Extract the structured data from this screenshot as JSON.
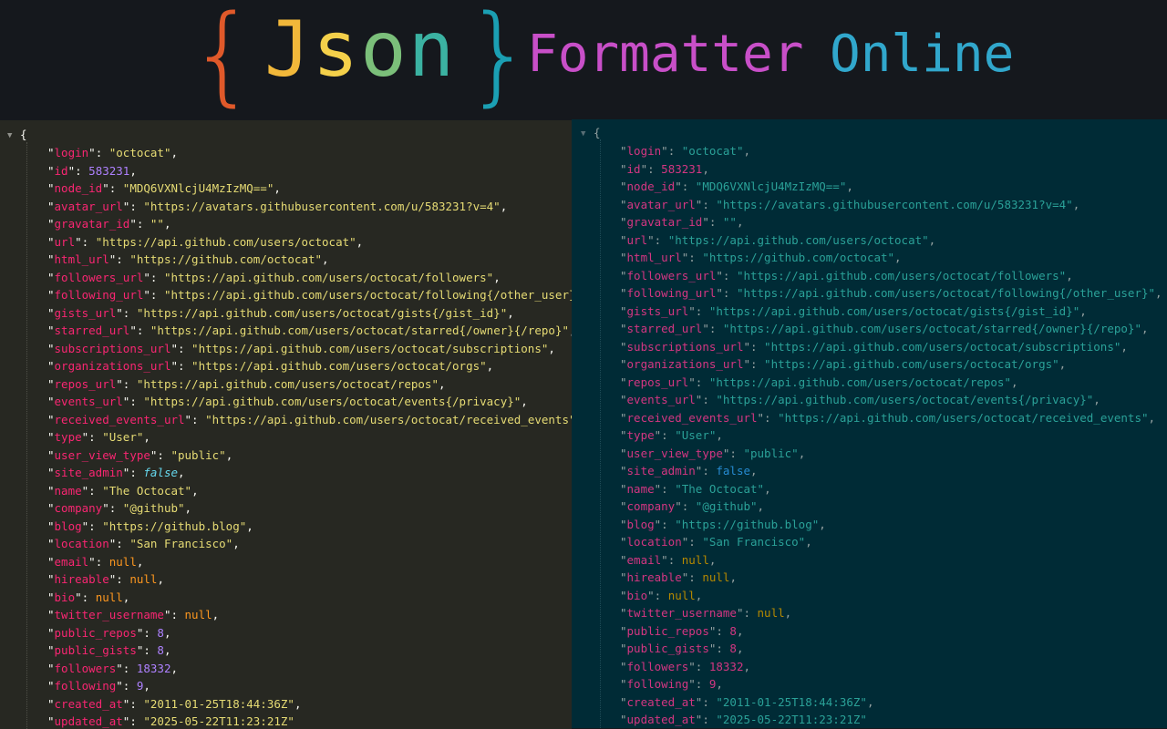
{
  "banner": {
    "brace_open": "{",
    "word_json": [
      "J",
      "s",
      "o",
      "n"
    ],
    "brace_close": "}",
    "word_formatter": "Formatter",
    "word_online": "Online"
  },
  "editor": {
    "root_open": "{",
    "fold_icon": "triangle-down",
    "colors": {
      "left_background": "#272822",
      "right_background": "#002b36",
      "banner_background": "#15181d"
    },
    "entries": [
      {
        "key": "login",
        "value": "\"octocat\"",
        "type": "string",
        "comma": ","
      },
      {
        "key": "id",
        "value": "583231",
        "type": "number",
        "comma": ","
      },
      {
        "key": "node_id",
        "value": "\"MDQ6VXNlcjU4MzIzMQ==\"",
        "type": "string",
        "comma": ","
      },
      {
        "key": "avatar_url",
        "value": "\"https://avatars.githubusercontent.com/u/583231?v=4\"",
        "type": "string",
        "comma": ","
      },
      {
        "key": "gravatar_id",
        "value": "\"\"",
        "type": "string",
        "comma": ","
      },
      {
        "key": "url",
        "value": "\"https://api.github.com/users/octocat\"",
        "type": "string",
        "comma": ","
      },
      {
        "key": "html_url",
        "value": "\"https://github.com/octocat\"",
        "type": "string",
        "comma": ","
      },
      {
        "key": "followers_url",
        "value": "\"https://api.github.com/users/octocat/followers\"",
        "type": "string",
        "comma": ","
      },
      {
        "key": "following_url",
        "value": "\"https://api.github.com/users/octocat/following{/other_user}\"",
        "type": "string",
        "comma": ","
      },
      {
        "key": "gists_url",
        "value": "\"https://api.github.com/users/octocat/gists{/gist_id}\"",
        "type": "string",
        "comma": ","
      },
      {
        "key": "starred_url",
        "value": "\"https://api.github.com/users/octocat/starred{/owner}{/repo}\"",
        "type": "string",
        "comma": ","
      },
      {
        "key": "subscriptions_url",
        "value": "\"https://api.github.com/users/octocat/subscriptions\"",
        "type": "string",
        "comma": ","
      },
      {
        "key": "organizations_url",
        "value": "\"https://api.github.com/users/octocat/orgs\"",
        "type": "string",
        "comma": ","
      },
      {
        "key": "repos_url",
        "value": "\"https://api.github.com/users/octocat/repos\"",
        "type": "string",
        "comma": ","
      },
      {
        "key": "events_url",
        "value": "\"https://api.github.com/users/octocat/events{/privacy}\"",
        "type": "string",
        "comma": ","
      },
      {
        "key": "received_events_url",
        "value": "\"https://api.github.com/users/octocat/received_events\"",
        "type": "string",
        "comma": ","
      },
      {
        "key": "type",
        "value": "\"User\"",
        "type": "string",
        "comma": ","
      },
      {
        "key": "user_view_type",
        "value": "\"public\"",
        "type": "string",
        "comma": ","
      },
      {
        "key": "site_admin",
        "value": "false",
        "type": "boolean",
        "comma": ","
      },
      {
        "key": "name",
        "value": "\"The Octocat\"",
        "type": "string",
        "comma": ","
      },
      {
        "key": "company",
        "value": "\"@github\"",
        "type": "string",
        "comma": ","
      },
      {
        "key": "blog",
        "value": "\"https://github.blog\"",
        "type": "string",
        "comma": ","
      },
      {
        "key": "location",
        "value": "\"San Francisco\"",
        "type": "string",
        "comma": ","
      },
      {
        "key": "email",
        "value": "null",
        "type": "null",
        "comma": ","
      },
      {
        "key": "hireable",
        "value": "null",
        "type": "null",
        "comma": ","
      },
      {
        "key": "bio",
        "value": "null",
        "type": "null",
        "comma": ","
      },
      {
        "key": "twitter_username",
        "value": "null",
        "type": "null",
        "comma": ","
      },
      {
        "key": "public_repos",
        "value": "8",
        "type": "number",
        "comma": ","
      },
      {
        "key": "public_gists",
        "value": "8",
        "type": "number",
        "comma": ","
      },
      {
        "key": "followers",
        "value": "18332",
        "type": "number",
        "comma": ","
      },
      {
        "key": "following",
        "value": "9",
        "type": "number",
        "comma": ","
      },
      {
        "key": "created_at",
        "value": "\"2011-01-25T18:44:36Z\"",
        "type": "string",
        "comma": ","
      },
      {
        "key": "updated_at",
        "value": "\"2025-05-22T11:23:21Z\"",
        "type": "string",
        "comma": ""
      }
    ]
  }
}
